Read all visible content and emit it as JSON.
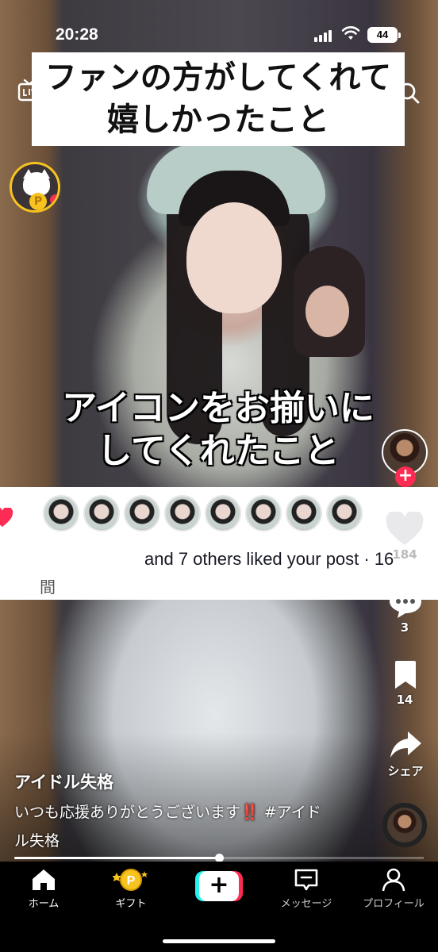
{
  "status_bar": {
    "time": "20:28",
    "battery": "44"
  },
  "overlay_captions": {
    "top_line1": "ファンの方がしてくれて",
    "top_line2": "嬉しかったこと",
    "mid_line1": "アイコンをお揃いに",
    "mid_line2": "してくれたこと"
  },
  "notification": {
    "liked_text": "and 7 others liked your post · 16",
    "time_unit": "間",
    "avatar_count": 8
  },
  "actions": {
    "like_count": "184",
    "comment_count": "3",
    "bookmark_count": "14",
    "share_label": "シェア"
  },
  "post": {
    "author": "アイドル失格",
    "desc_before": "いつも応援ありがとうございます",
    "desc_emoji": "‼️",
    "desc_after": " #アイドル失格"
  },
  "bottom_nav": {
    "home": "ホーム",
    "gift": "ギフト",
    "messages": "メッセージ",
    "profile": "プロフィール",
    "create": "+"
  },
  "colors": {
    "accent_red": "#fe2c55",
    "accent_cyan": "#25f4ee",
    "gold": "#f7c321"
  },
  "video_progress": 0.5
}
